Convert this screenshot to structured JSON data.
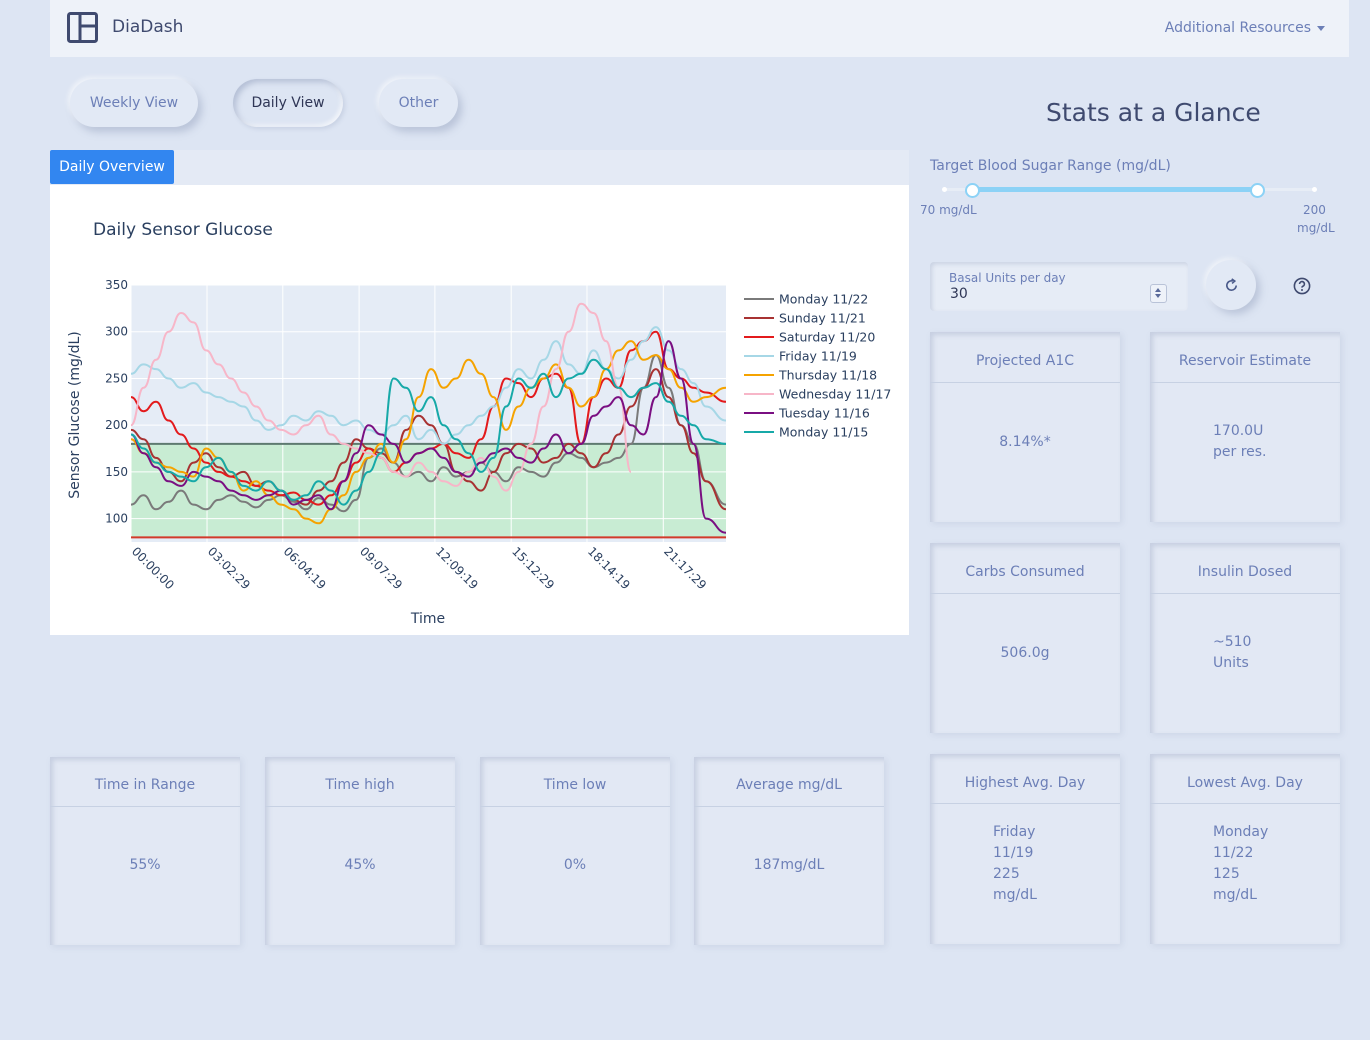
{
  "app": {
    "brand": "DiaDash",
    "resources_label": "Additional Resources"
  },
  "nav": {
    "pills": [
      "Weekly View",
      "Daily View",
      "Other"
    ],
    "active": "Daily View"
  },
  "tab": {
    "label": "Daily Overview"
  },
  "stats": {
    "title": "Stats at a Glance",
    "range_label": "Target Blood Sugar Range (mg/dL)",
    "range_min_label": "70 mg/dL",
    "range_max_label_1": "200",
    "range_max_label_2": "mg/dL",
    "range_low": 80,
    "range_high": 180,
    "range_min": 70,
    "range_max": 200,
    "basal_label": "Basal Units per day",
    "basal_value": "30"
  },
  "cards": {
    "a1c": {
      "title": "Projected A1C",
      "value": "8.14%*"
    },
    "reservoir": {
      "title": "Reservoir Estimate",
      "line1": "170.0U",
      "line2": "per res."
    },
    "carbs": {
      "title": "Carbs Consumed",
      "value": "506.0g"
    },
    "insulin": {
      "title": "Insulin Dosed",
      "line1": "~510",
      "line2": "Units"
    },
    "highest": {
      "title": "Highest Avg. Day",
      "l1": "Friday",
      "l2": "11/19",
      "l3": "225",
      "l4": "mg/dL"
    },
    "lowest": {
      "title": "Lowest Avg. Day",
      "l1": "Monday",
      "l2": "11/22",
      "l3": "125",
      "l4": "mg/dL"
    },
    "tir": {
      "title": "Time in Range",
      "value": "55%"
    },
    "high": {
      "title": "Time high",
      "value": "45%"
    },
    "low": {
      "title": "Time low",
      "value": "0%"
    },
    "avg": {
      "title": "Average mg/dL",
      "value": "187mg/dL"
    }
  },
  "chart_data": {
    "type": "line",
    "title": "Daily Sensor Glucose",
    "xlabel": "Time",
    "ylabel": "Sensor Glucose (mg/dL)",
    "x_ticks": [
      "00:00:00",
      "03:02:29",
      "06:04:19",
      "09:07:29",
      "12:09:19",
      "15:12:29",
      "18:14:19",
      "21:17:29"
    ],
    "y_ticks": [
      100,
      150,
      200,
      250,
      300,
      350
    ],
    "xlim": [
      0,
      23.8
    ],
    "ylim": [
      75,
      350
    ],
    "target_range": [
      80,
      180
    ],
    "series": [
      {
        "name": "Monday 11/22",
        "color": "#7a7a7a",
        "x": [
          0,
          0.5,
          1,
          1.5,
          2,
          2.5,
          3,
          3.5,
          4,
          4.5,
          5,
          5.5,
          6,
          6.5,
          7,
          7.5,
          8,
          8.5,
          9,
          9.5,
          10,
          10.5,
          11,
          11.5,
          12,
          12.5,
          13,
          13.5,
          14,
          14.5,
          15,
          15.5,
          16,
          16.5,
          17,
          17.5,
          18,
          18.5,
          19,
          19.5,
          20,
          20.5,
          21,
          21.5,
          22,
          22.5,
          23,
          23.8
        ],
        "y": [
          115,
          125,
          110,
          118,
          130,
          115,
          110,
          120,
          125,
          118,
          112,
          120,
          125,
          118,
          110,
          122,
          115,
          108,
          120,
          165,
          175,
          160,
          145,
          150,
          140,
          155,
          145,
          150,
          160,
          150,
          140,
          155,
          150,
          145,
          160,
          170,
          165,
          155,
          160,
          165,
          180,
          240,
          275,
          240,
          200,
          180,
          140,
          115
        ]
      },
      {
        "name": "Sunday 11/21",
        "color": "#a83232",
        "x": [
          0,
          0.5,
          1,
          1.5,
          2,
          2.5,
          3,
          3.5,
          4,
          4.5,
          5,
          5.5,
          6,
          6.5,
          7,
          7.5,
          8,
          8.5,
          9,
          9.5,
          10,
          10.5,
          11,
          11.5,
          12,
          12.5,
          13,
          13.5,
          14,
          14.5,
          15,
          15.5,
          16,
          16.5,
          17,
          17.5,
          18,
          18.5,
          19,
          19.5,
          20,
          20.5,
          21,
          21.5,
          22,
          22.5,
          23,
          23.8
        ],
        "y": [
          195,
          185,
          165,
          150,
          140,
          160,
          170,
          155,
          145,
          150,
          135,
          140,
          130,
          120,
          115,
          130,
          140,
          160,
          185,
          175,
          170,
          160,
          195,
          210,
          200,
          180,
          150,
          140,
          130,
          150,
          170,
          180,
          175,
          160,
          165,
          180,
          170,
          155,
          170,
          190,
          220,
          240,
          260,
          230,
          200,
          170,
          140,
          110
        ]
      },
      {
        "name": "Saturday 11/20",
        "color": "#e31a1c",
        "x": [
          0,
          0.5,
          1,
          1.5,
          2,
          2.5,
          3,
          3.5,
          4,
          4.5,
          5,
          5.5,
          6,
          6.5,
          7,
          7.5,
          8,
          8.5,
          9,
          9.5,
          10,
          10.5,
          11,
          11.5,
          12,
          12.5,
          13,
          13.5,
          14,
          14.5,
          15,
          15.5,
          16,
          16.5,
          17,
          17.5,
          18,
          18.5,
          19,
          19.5,
          20,
          20.5,
          21,
          21.5,
          22,
          22.5,
          23,
          23.8
        ],
        "y": [
          230,
          215,
          225,
          205,
          190,
          175,
          160,
          150,
          145,
          140,
          135,
          130,
          125,
          128,
          120,
          115,
          125,
          140,
          160,
          175,
          165,
          150,
          160,
          170,
          175,
          180,
          170,
          165,
          185,
          220,
          250,
          245,
          230,
          250,
          255,
          240,
          180,
          230,
          250,
          240,
          280,
          290,
          300,
          260,
          250,
          240,
          235,
          225
        ]
      },
      {
        "name": "Friday 11/19",
        "color": "#a6d7e6",
        "x": [
          0,
          0.5,
          1,
          1.5,
          2,
          2.5,
          3,
          3.5,
          4,
          4.5,
          5,
          5.5,
          6,
          6.5,
          7,
          7.5,
          8,
          8.5,
          9,
          9.5,
          10,
          10.5,
          11,
          11.5,
          12,
          12.5,
          13,
          13.5,
          14,
          14.5,
          15,
          15.5,
          16,
          16.5,
          17,
          17.5,
          18,
          18.5,
          19,
          19.5,
          20,
          20.5,
          21,
          21.5,
          22,
          22.5,
          23,
          23.8
        ],
        "y": [
          255,
          265,
          260,
          250,
          240,
          245,
          235,
          230,
          225,
          220,
          205,
          195,
          200,
          210,
          205,
          215,
          210,
          200,
          205,
          195,
          190,
          200,
          210,
          185,
          195,
          180,
          190,
          200,
          210,
          220,
          240,
          260,
          250,
          270,
          290,
          265,
          255,
          280,
          260,
          250,
          270,
          290,
          305,
          280,
          260,
          245,
          220,
          205
        ]
      },
      {
        "name": "Thursday 11/18",
        "color": "#f5a300",
        "x": [
          0,
          0.5,
          1,
          1.5,
          2,
          2.5,
          3,
          3.5,
          4,
          4.5,
          5,
          5.5,
          6,
          6.5,
          7,
          7.5,
          8,
          8.5,
          9,
          9.5,
          10,
          10.5,
          11,
          11.5,
          12,
          12.5,
          13,
          13.5,
          14,
          14.5,
          15,
          15.5,
          16,
          16.5,
          17,
          17.5,
          18,
          18.5,
          19,
          19.5,
          20,
          20.5,
          21,
          21.5,
          22,
          22.5,
          23,
          23.8
        ],
        "y": [
          185,
          170,
          160,
          155,
          150,
          145,
          175,
          165,
          150,
          130,
          140,
          125,
          115,
          110,
          100,
          95,
          110,
          125,
          150,
          165,
          180,
          160,
          185,
          230,
          260,
          240,
          250,
          270,
          255,
          230,
          195,
          220,
          240,
          250,
          265,
          240,
          220,
          230,
          260,
          280,
          290,
          270,
          275,
          260,
          240,
          225,
          230,
          240
        ]
      },
      {
        "name": "Wednesday 11/17",
        "color": "#f7b6c8",
        "x": [
          0,
          0.5,
          1,
          1.5,
          2,
          2.5,
          3,
          3.5,
          4,
          4.5,
          5,
          5.5,
          6,
          6.5,
          7,
          7.5,
          8,
          8.5,
          9,
          9.5,
          10,
          10.5,
          11,
          11.5,
          12,
          12.5,
          13,
          13.5,
          14,
          14.5,
          15,
          15.5,
          16,
          16.5,
          17,
          17.5,
          18,
          18.5,
          19,
          19.5,
          20
        ],
        "y": [
          200,
          240,
          270,
          300,
          320,
          310,
          280,
          265,
          250,
          235,
          220,
          205,
          195,
          190,
          200,
          210,
          190,
          180,
          175,
          170,
          165,
          150,
          145,
          160,
          150,
          140,
          135,
          150,
          165,
          145,
          130,
          150,
          180,
          220,
          260,
          300,
          330,
          320,
          290,
          240,
          150
        ]
      },
      {
        "name": "Tuesday 11/16",
        "color": "#7a0f82",
        "x": [
          0,
          0.5,
          1,
          1.5,
          2,
          2.5,
          3,
          3.5,
          4,
          4.5,
          5,
          5.5,
          6,
          6.5,
          7,
          7.5,
          8,
          8.5,
          9,
          9.5,
          10,
          10.5,
          11,
          11.5,
          12,
          12.5,
          13,
          13.5,
          14,
          14.5,
          15,
          15.5,
          16,
          16.5,
          17,
          17.5,
          18,
          18.5,
          19,
          19.5,
          20,
          20.5,
          21,
          21.5,
          22,
          22.5,
          23,
          23.8
        ],
        "y": [
          190,
          170,
          155,
          140,
          135,
          150,
          145,
          140,
          130,
          125,
          120,
          125,
          130,
          115,
          120,
          125,
          110,
          140,
          170,
          200,
          190,
          180,
          160,
          170,
          175,
          165,
          150,
          145,
          160,
          170,
          175,
          165,
          160,
          175,
          190,
          170,
          180,
          210,
          220,
          230,
          200,
          190,
          230,
          290,
          250,
          180,
          100,
          85
        ]
      },
      {
        "name": "Monday 11/15",
        "color": "#17a9a8",
        "x": [
          0,
          0.5,
          1,
          1.5,
          2,
          2.5,
          3,
          3.5,
          4,
          4.5,
          5,
          5.5,
          6,
          6.5,
          7,
          7.5,
          8,
          8.5,
          9,
          9.5,
          10,
          10.5,
          11,
          11.5,
          12,
          12.5,
          13,
          13.5,
          14,
          14.5,
          15,
          15.5,
          16,
          16.5,
          17,
          17.5,
          18,
          18.5,
          19,
          19.5,
          20,
          20.5,
          21,
          21.5,
          22,
          22.5,
          23,
          23.8
        ],
        "y": [
          190,
          175,
          160,
          150,
          145,
          140,
          155,
          165,
          150,
          135,
          130,
          140,
          130,
          120,
          125,
          140,
          130,
          115,
          130,
          150,
          170,
          250,
          240,
          215,
          230,
          200,
          185,
          170,
          150,
          165,
          220,
          250,
          240,
          255,
          230,
          250,
          255,
          270,
          260,
          240,
          230,
          240,
          245,
          225,
          210,
          200,
          185,
          180
        ]
      }
    ]
  }
}
